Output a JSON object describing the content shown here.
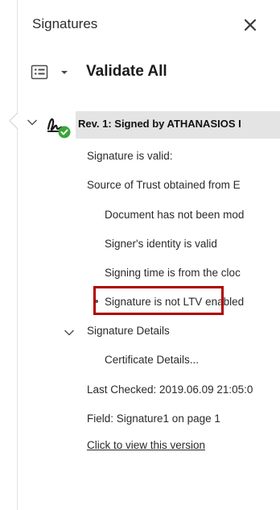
{
  "panel": {
    "title": "Signatures",
    "close_icon": "close-icon",
    "options_icon": "options-menu-icon",
    "validate_all_label": "Validate All"
  },
  "signature": {
    "title": "Rev. 1: Signed by ATHANASIOS I",
    "icon": "signature-valid-icon",
    "status_color": "#3aa53a",
    "details": {
      "signature_valid": "Signature is valid:",
      "source_of_trust": "Source of Trust obtained from E",
      "doc_not_modified": "Document has not been mod",
      "identity_valid": "Signer's identity is valid",
      "signing_time": "Signing time is from the cloc",
      "not_ltv": "Signature is not LTV enabled",
      "signature_details": "Signature Details",
      "certificate_details": "Certificate Details...",
      "last_checked": "Last Checked: 2019.06.09 21:05:0",
      "field": "Field: Signature1 on page 1",
      "view_version": "Click to view this version"
    }
  },
  "highlight_color": "#b00000"
}
